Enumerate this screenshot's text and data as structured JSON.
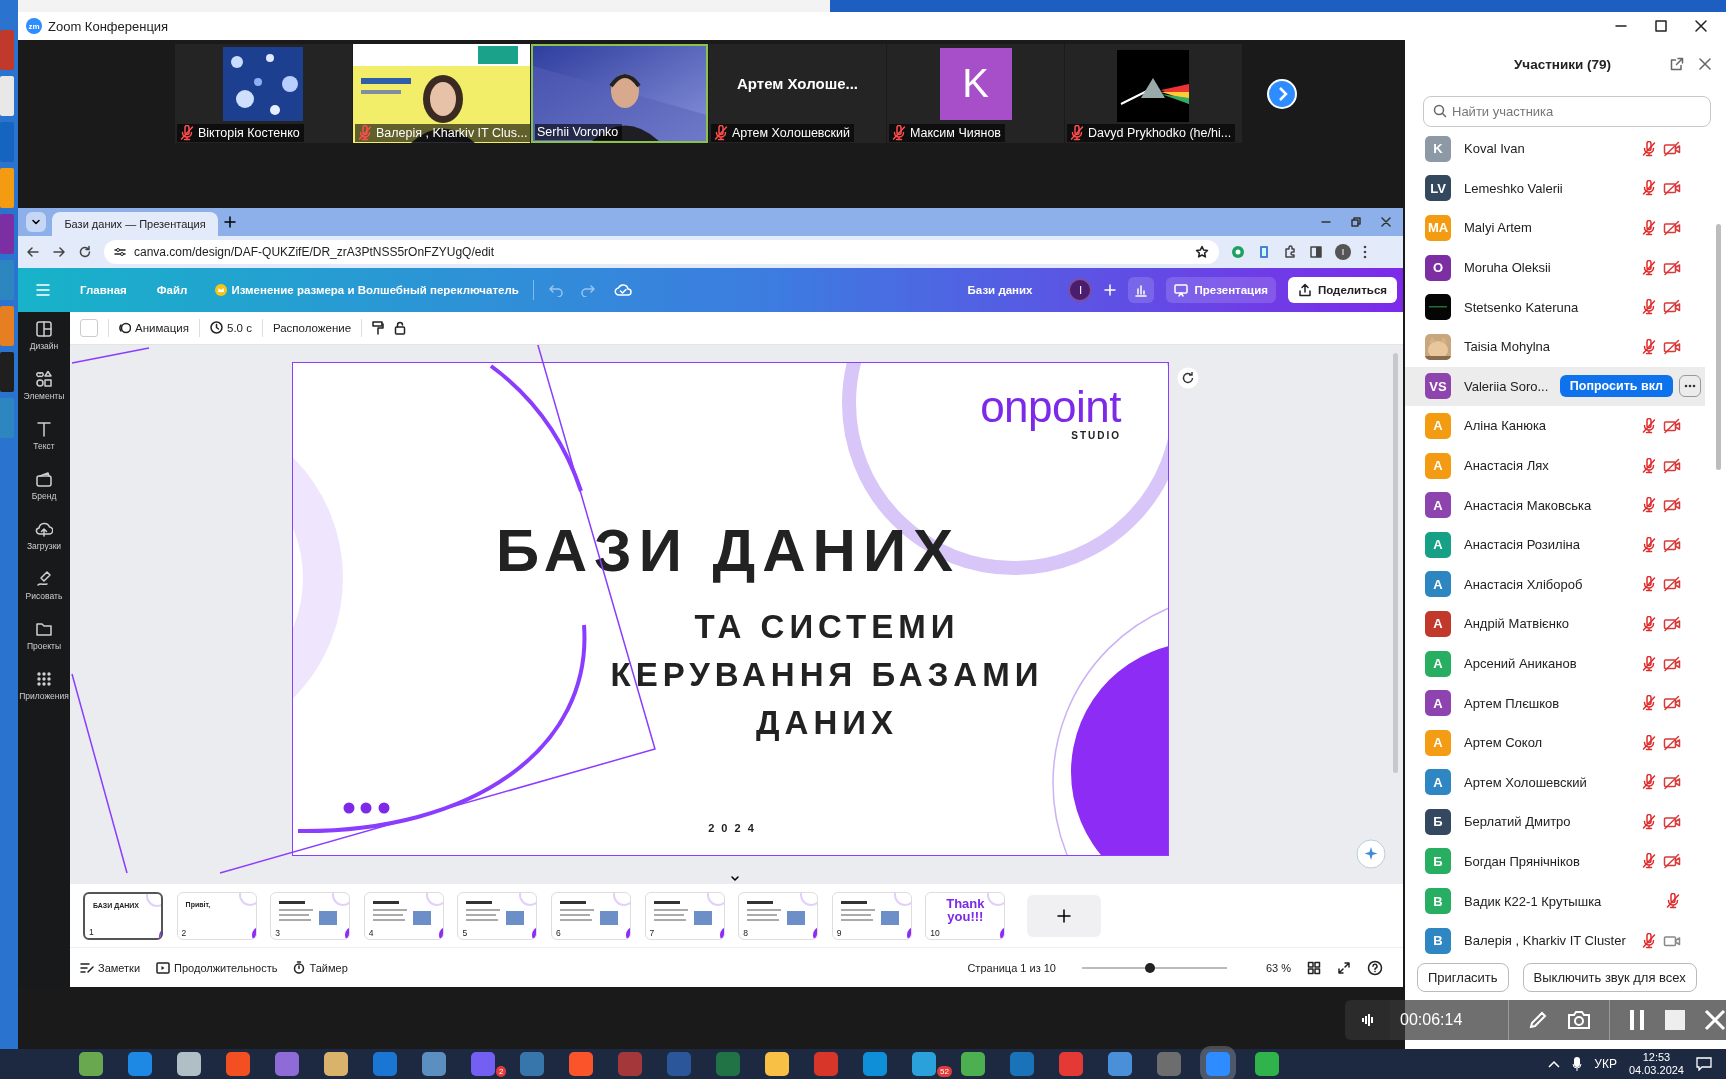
{
  "window": {
    "logo_text": "zm",
    "title": "Zoom Конференция"
  },
  "video_strip": {
    "tiles": [
      {
        "name": "Вікторія Костенко",
        "muted": true,
        "kind": "picture",
        "active_speaker": false
      },
      {
        "name": "Валерія , Kharkiv IT Clus...",
        "muted": true,
        "kind": "picture",
        "active_speaker": false
      },
      {
        "name": "Serhii Voronko",
        "muted": false,
        "kind": "picture",
        "active_speaker": true
      },
      {
        "name": "Артем Холошевский",
        "muted": true,
        "kind": "name",
        "display_name": "Артем  Холоше...",
        "active_speaker": false
      },
      {
        "name": "Максим Чиянов",
        "muted": true,
        "kind": "avatar",
        "initial": "K",
        "color": "#a64fc9",
        "active_speaker": false
      },
      {
        "name": "Davyd Prykhodko (he/hi...",
        "muted": true,
        "kind": "picture",
        "active_speaker": false
      }
    ]
  },
  "shared_screen": {
    "browser": {
      "tab_title": "Бази даних — Презентация",
      "url": "canva.com/design/DAF-QUKZifE/DR_zrA3PtNSS5rOnFZYUgQ/edit",
      "profile_initial": "I"
    },
    "canva": {
      "menu": [
        "Главная",
        "Файл"
      ],
      "promo": "Изменение размера и Волшебный переключатель",
      "design_title": "Бази даних",
      "user_initial": "I",
      "present_button": "Презентация",
      "share_button": "Поделиться",
      "toolbar": {
        "animation": "Анимация",
        "duration": "5.0 с",
        "position": "Расположение"
      },
      "side_nav": [
        {
          "label": "Дизайн",
          "kind": "design"
        },
        {
          "label": "Элементы",
          "kind": "elements"
        },
        {
          "label": "Текст",
          "kind": "text"
        },
        {
          "label": "Бренд",
          "kind": "brand"
        },
        {
          "label": "Загрузки",
          "kind": "uploads"
        },
        {
          "label": "Рисовать",
          "kind": "draw"
        },
        {
          "label": "Проекты",
          "kind": "projects"
        },
        {
          "label": "Приложения",
          "kind": "apps"
        }
      ],
      "slide": {
        "logo": "onpoint",
        "logo_sub": "STUDIO",
        "title": "БАЗИ ДАНИХ",
        "subtitle": "ТА СИСТЕМИ КЕРУВАННЯ БАЗАМИ ДАНИХ",
        "year": "2 0 2 4"
      },
      "thumbnails": [
        {
          "number": "1",
          "title": "БАЗИ ДАНИХ",
          "selected": true
        },
        {
          "number": "2",
          "title": "Привіт,",
          "selected": false
        },
        {
          "number": "3",
          "selected": false
        },
        {
          "number": "4",
          "selected": false
        },
        {
          "number": "5",
          "selected": false
        },
        {
          "number": "6",
          "selected": false
        },
        {
          "number": "7",
          "selected": false
        },
        {
          "number": "8",
          "selected": false
        },
        {
          "number": "9",
          "selected": false
        },
        {
          "number": "10",
          "title": "Thank you!!!",
          "selected": false
        }
      ],
      "footer": {
        "notes": "Заметки",
        "duration": "Продолжительность",
        "timer": "Таймер",
        "page": "Страница 1 из 10",
        "zoom": {
          "level": 0.47
        },
        "zoom_reading": "63 %"
      }
    }
  },
  "participants": {
    "title": "Участники (79)",
    "search": {
      "placeholder": "Найти участника"
    },
    "list": [
      {
        "name": "Koval Ivan",
        "initials": "K",
        "color": "#8d9aa5",
        "hovered": false,
        "mic_muted": true,
        "video_off": true
      },
      {
        "name": "Lemeshko Valerii",
        "initials": "LV",
        "color": "#34495e",
        "hovered": false,
        "mic_muted": true,
        "video_off": true
      },
      {
        "name": "Malyi Artem",
        "initials": "MA",
        "color": "#f39c12",
        "hovered": false,
        "mic_muted": true,
        "video_off": true
      },
      {
        "name": "Moruha Oleksii",
        "initials": "O",
        "color": "#7b2fa2",
        "hovered": false,
        "mic_muted": true,
        "video_off": true
      },
      {
        "name": "Stetsenko Kateruna",
        "kind": "picture",
        "hovered": false,
        "mic_muted": true,
        "video_off": true
      },
      {
        "name": "Taisia Mohylna",
        "kind": "picture",
        "hovered": false,
        "mic_muted": true,
        "video_off": true
      },
      {
        "name": "Valeriia Soro...",
        "initials": "VS",
        "color": "#8e44ad",
        "hovered": true,
        "action": "Попросить вкл"
      },
      {
        "name": "Аліна Канюка",
        "initials": "А",
        "color": "#f39c12",
        "hovered": false,
        "mic_muted": true,
        "video_off": true
      },
      {
        "name": "Анастасія Лях",
        "initials": "А",
        "color": "#f39c13",
        "hovered": false,
        "mic_muted": true,
        "video_off": true
      },
      {
        "name": "Анастасія Маковська",
        "initials": "А",
        "color": "#8e44ae",
        "hovered": false,
        "mic_muted": true,
        "video_off": true
      },
      {
        "name": "Анастасія Розиліна",
        "initials": "А",
        "color": "#16a085",
        "hovered": false,
        "mic_muted": true,
        "video_off": true
      },
      {
        "name": "Анастасія Хлібороб",
        "initials": "А",
        "color": "#2e86c1",
        "hovered": false,
        "mic_muted": true,
        "video_off": true
      },
      {
        "name": "Андрій Матвієнко",
        "initials": "А",
        "color": "#c0392b",
        "hovered": false,
        "mic_muted": true,
        "video_off": true
      },
      {
        "name": "Арсений Аниканов",
        "initials": "А",
        "color": "#27ae60",
        "hovered": false,
        "mic_muted": true,
        "video_off": true
      },
      {
        "name": "Артем Плєшков",
        "initials": "А",
        "color": "#8e44af",
        "hovered": false,
        "mic_muted": true,
        "video_off": true
      },
      {
        "name": "Артем Сокол",
        "initials": "А",
        "color": "#f39c14",
        "hovered": false,
        "mic_muted": true,
        "video_off": true
      },
      {
        "name": "Артем Холошевский",
        "initials": "А",
        "color": "#2e86c2",
        "hovered": false,
        "mic_muted": true,
        "video_off": true
      },
      {
        "name": "Берлатий Дмитро",
        "initials": "Б",
        "color": "#34495f",
        "hovered": false,
        "mic_muted": true,
        "video_off": true
      },
      {
        "name": "Богдан Прянічніков",
        "initials": "Б",
        "color": "#27ae61",
        "hovered": false,
        "mic_muted": true,
        "video_off": true
      },
      {
        "name": "Вадик К22-1 Крутышка",
        "initials": "В",
        "color": "#27ae62",
        "hovered": false,
        "mic_muted": true
      },
      {
        "name": "Валерія , Kharkiv IT Cluster",
        "initials": "В",
        "color": "#2e86c3",
        "hovered": false,
        "mic_muted": true,
        "video_off": false
      }
    ],
    "buttons": [
      "Пригласить",
      "Выключить звук для всех"
    ]
  },
  "recording": {
    "time": "00:06:14"
  },
  "taskbar": {
    "apps": [
      {
        "color": "#6aa84f",
        "selected": false
      },
      {
        "color": "#1e88e5",
        "selected": false
      },
      {
        "color": "#b0bec5",
        "selected": false
      },
      {
        "color": "#f25022",
        "selected": false
      },
      {
        "color": "#8e6bd6",
        "selected": false
      },
      {
        "color": "#d9b36c",
        "selected": false
      },
      {
        "color": "#1976d2",
        "selected": false
      },
      {
        "color": "#5a8fc0",
        "selected": false
      },
      {
        "color": "#7360f2",
        "selected": false,
        "badge": "2"
      },
      {
        "color": "#3776ab",
        "selected": false
      },
      {
        "color": "#fb542b",
        "selected": false
      },
      {
        "color": "#a4373a",
        "selected": false
      },
      {
        "color": "#2b579a",
        "selected": false
      },
      {
        "color": "#217346",
        "selected": false
      },
      {
        "color": "#f8c146",
        "selected": false
      },
      {
        "color": "#d9362a",
        "selected": false
      },
      {
        "color": "#0f8fd8",
        "selected": false
      },
      {
        "color": "#2aa1da",
        "selected": false,
        "badge": "52"
      },
      {
        "color": "#4caf50",
        "selected": false
      },
      {
        "color": "#1a73b8",
        "selected": false
      },
      {
        "color": "#e53935",
        "selected": false
      },
      {
        "color": "#4a90d9",
        "selected": false
      },
      {
        "color": "#6d6d6d",
        "selected": false
      },
      {
        "color": "#2d8cff",
        "selected": true
      },
      {
        "color": "#2fb34a",
        "selected": false
      }
    ],
    "language": "УКР",
    "time": "12:53",
    "date": "04.03.2024"
  }
}
